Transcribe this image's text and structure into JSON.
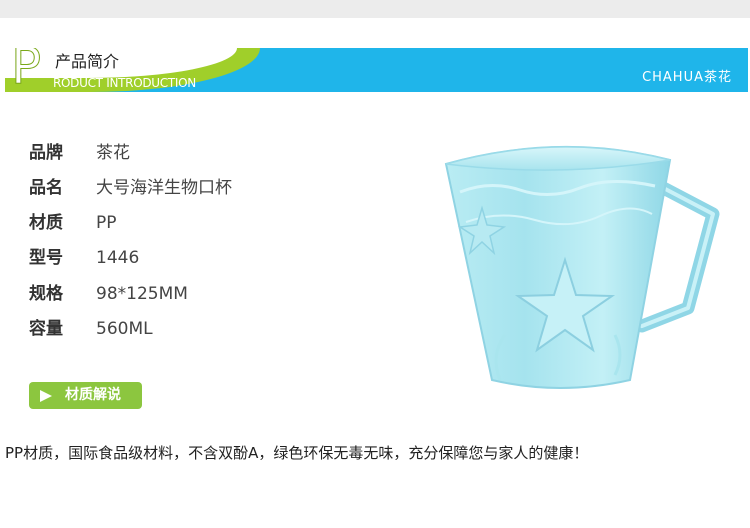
{
  "header": {
    "letter": "P",
    "title_cn": "产品简介",
    "title_en": "RODUCT INTRODUCTION",
    "brand": "CHAHUA茶花"
  },
  "specs": [
    {
      "label": "品牌",
      "value": "茶花"
    },
    {
      "label": "品名",
      "value": "大号海洋生物口杯"
    },
    {
      "label": "材质",
      "value": "PP"
    },
    {
      "label": "型号",
      "value": "1446"
    },
    {
      "label": "规格",
      "value": "98*125MM"
    },
    {
      "label": "容量",
      "value": "560ML"
    }
  ],
  "material_button": {
    "label": "材质解说",
    "icon": "play-icon"
  },
  "description": "PP材质，国际食品级材料，不含双酚A，绿色环保无毒无味，充分保障您与家人的健康！",
  "colors": {
    "banner_blue": "#1fb5ea",
    "banner_green": "#a0cf2a",
    "button_green": "#8cc63f",
    "cup": "#9fe3ee"
  }
}
